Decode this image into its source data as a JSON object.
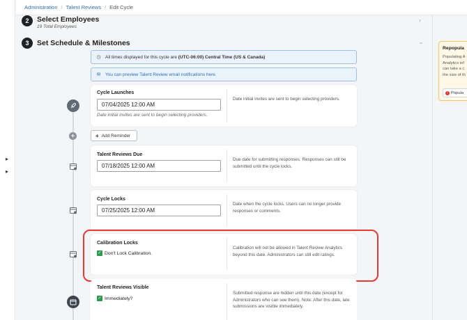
{
  "breadcrumb": [
    "Administration",
    "Talent Reviews",
    "Edit Cycle"
  ],
  "steps": [
    {
      "num": "2",
      "title": "Select Employees",
      "sub": "19 Total Employees"
    },
    {
      "num": "3",
      "title": "Set Schedule & Milestones"
    }
  ],
  "info": {
    "timezone_prefix": "All times displayed for this cycle are ",
    "timezone_bold": "(UTC-06:00) Central Time (US & Canada)",
    "preview_link": "You can preview Talent Review email notifications here."
  },
  "cards": {
    "cycle_launches": {
      "label": "Cycle Launches",
      "value": "07/04/2025 12:00 AM",
      "hint": "Date initial invites are sent to begin selecting providers.",
      "desc": "Date initial invites are sent to begin selecting providers."
    },
    "add_reminder": "Add Reminder",
    "reviews_due": {
      "label": "Talent Reviews Due",
      "value": "07/18/2025 12:00 AM",
      "desc": "Due date for submitting responses. Responses can still be submitted until the cycle locks."
    },
    "cycle_locks": {
      "label": "Cycle Locks",
      "value": "07/25/2025 12:00 AM",
      "desc": "Date when the cycle locks. Users can no longer provide responses or comments."
    },
    "calibration_locks": {
      "label": "Calibration Locks",
      "checkbox": "Don't Lock Calibration.",
      "desc": "Calibration will not be allowed in Talent Review Analytics beyond this date. Administrators can still edit ratings."
    },
    "reviews_visible": {
      "label": "Talent Reviews Visible",
      "checkbox": "Immediately?",
      "desc": "Submitted response are hidden until this date (except for Administrators who can see them). Note: After this date, late submissions are visible immediately."
    }
  },
  "side_panel": {
    "title": "Repopula",
    "lines": [
      "Populating A",
      "Analytics inf",
      "can take a c",
      "the size of th"
    ],
    "button": "Popula"
  },
  "colors": {
    "link": "#2f6fb6",
    "check": "#2e9a4a",
    "highlight": "#e53935",
    "step_badge": "#1f2328"
  }
}
